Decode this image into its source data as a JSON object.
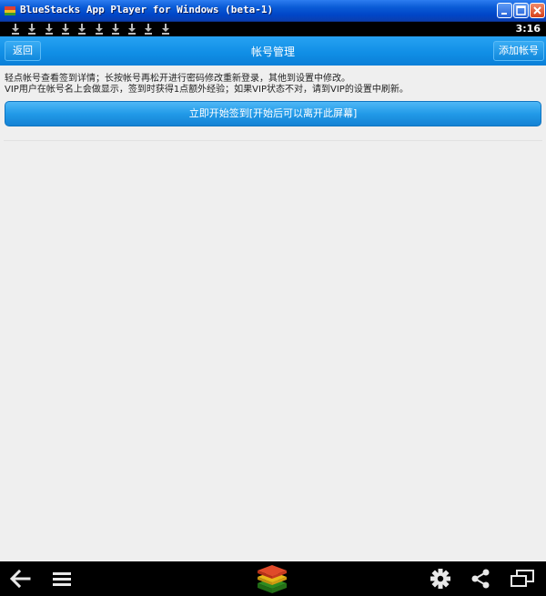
{
  "window": {
    "title": "BlueStacks App Player for Windows (beta-1)",
    "icons": [
      "bluestacks-logo-icon",
      "minimize-icon",
      "maximize-icon",
      "close-icon"
    ]
  },
  "status_bar": {
    "time": "3:16",
    "download_icon_count": 10
  },
  "action_bar": {
    "back_label": "返回",
    "title": "帐号管理",
    "add_label": "添加帐号"
  },
  "content": {
    "notice_line1": "轻点帐号查看签到详情；长按帐号再松开进行密码修改重新登录，其他到设置中修改。",
    "notice_line2": "VIP用户在帐号名上会做显示，签到时获得1点额外经验；如果VIP状态不对，请到VIP的设置中刷新。",
    "signin_button": "立即开始签到[开始后可以离开此屏幕]"
  },
  "nav_bar": {
    "icons": [
      "back-arrow-icon",
      "menu-icon",
      "bluestacks-home-icon",
      "settings-gear-icon",
      "share-icon",
      "screen-rotate-icon"
    ]
  },
  "colors": {
    "title_bar": "#0054e3",
    "action_bar": "#1490e8",
    "button": "#229ae8",
    "background": "#efefef"
  }
}
